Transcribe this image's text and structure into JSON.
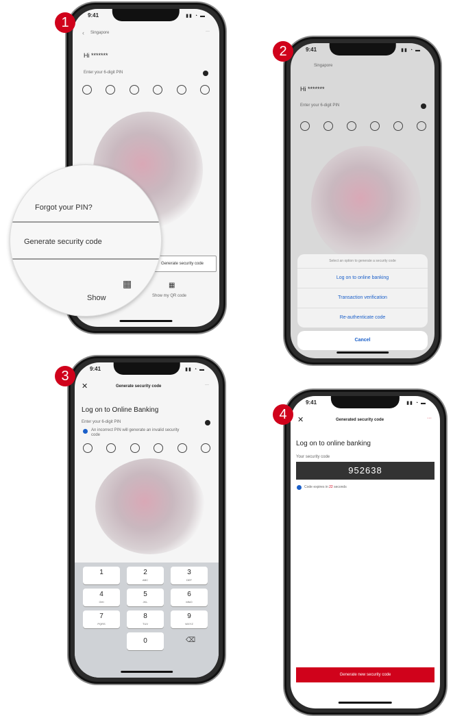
{
  "steps": [
    "1",
    "2",
    "3",
    "4"
  ],
  "phone1": {
    "time": "9:41",
    "country": "Singapore",
    "menu": "···",
    "greeting": "Hi *******",
    "pin_prompt": "Enter your 6-digit PIN",
    "magnifier": {
      "forgot_pin": "Forgot your PIN?",
      "generate_code": "Generate security code",
      "show": "Show"
    },
    "generate_button": "Generate security code",
    "show_qr": "Show my QR code"
  },
  "phone2": {
    "time": "9:41",
    "country": "Singapore",
    "greeting": "Hi *******",
    "pin_prompt": "Enter your 6-digit PIN",
    "sheet_title": "Select an option to generate a security code",
    "options": [
      "Log on to online banking",
      "Transaction verification",
      "Re-authenticate code"
    ],
    "cancel": "Cancel"
  },
  "phone3": {
    "time": "9:41",
    "title": "Generate security code",
    "menu": "···",
    "heading": "Log on to Online Banking",
    "pin_prompt": "Enter your 6-digit PIN",
    "note": "An incorrect PIN will generate an invalid security code",
    "keys": [
      {
        "num": "1",
        "sub": ""
      },
      {
        "num": "2",
        "sub": "ABC"
      },
      {
        "num": "3",
        "sub": "DEF"
      },
      {
        "num": "4",
        "sub": "GHI"
      },
      {
        "num": "5",
        "sub": "JKL"
      },
      {
        "num": "6",
        "sub": "MNO"
      },
      {
        "num": "7",
        "sub": "PQRS"
      },
      {
        "num": "8",
        "sub": "TUV"
      },
      {
        "num": "9",
        "sub": "WXYZ"
      },
      {
        "num": "0",
        "sub": ""
      }
    ]
  },
  "phone4": {
    "time": "9:41",
    "title": "Generated security code",
    "menu": "···",
    "heading": "Log on to online banking",
    "code_label": "Your security code",
    "code": "952638",
    "expiry_prefix": "Code expires in ",
    "expiry_seconds": "22",
    "expiry_suffix": " seconds",
    "generate_new": "Generate new security code"
  },
  "colors": {
    "accent": "#d0021b",
    "link": "#1a5fc9",
    "code_bg": "#333333"
  }
}
